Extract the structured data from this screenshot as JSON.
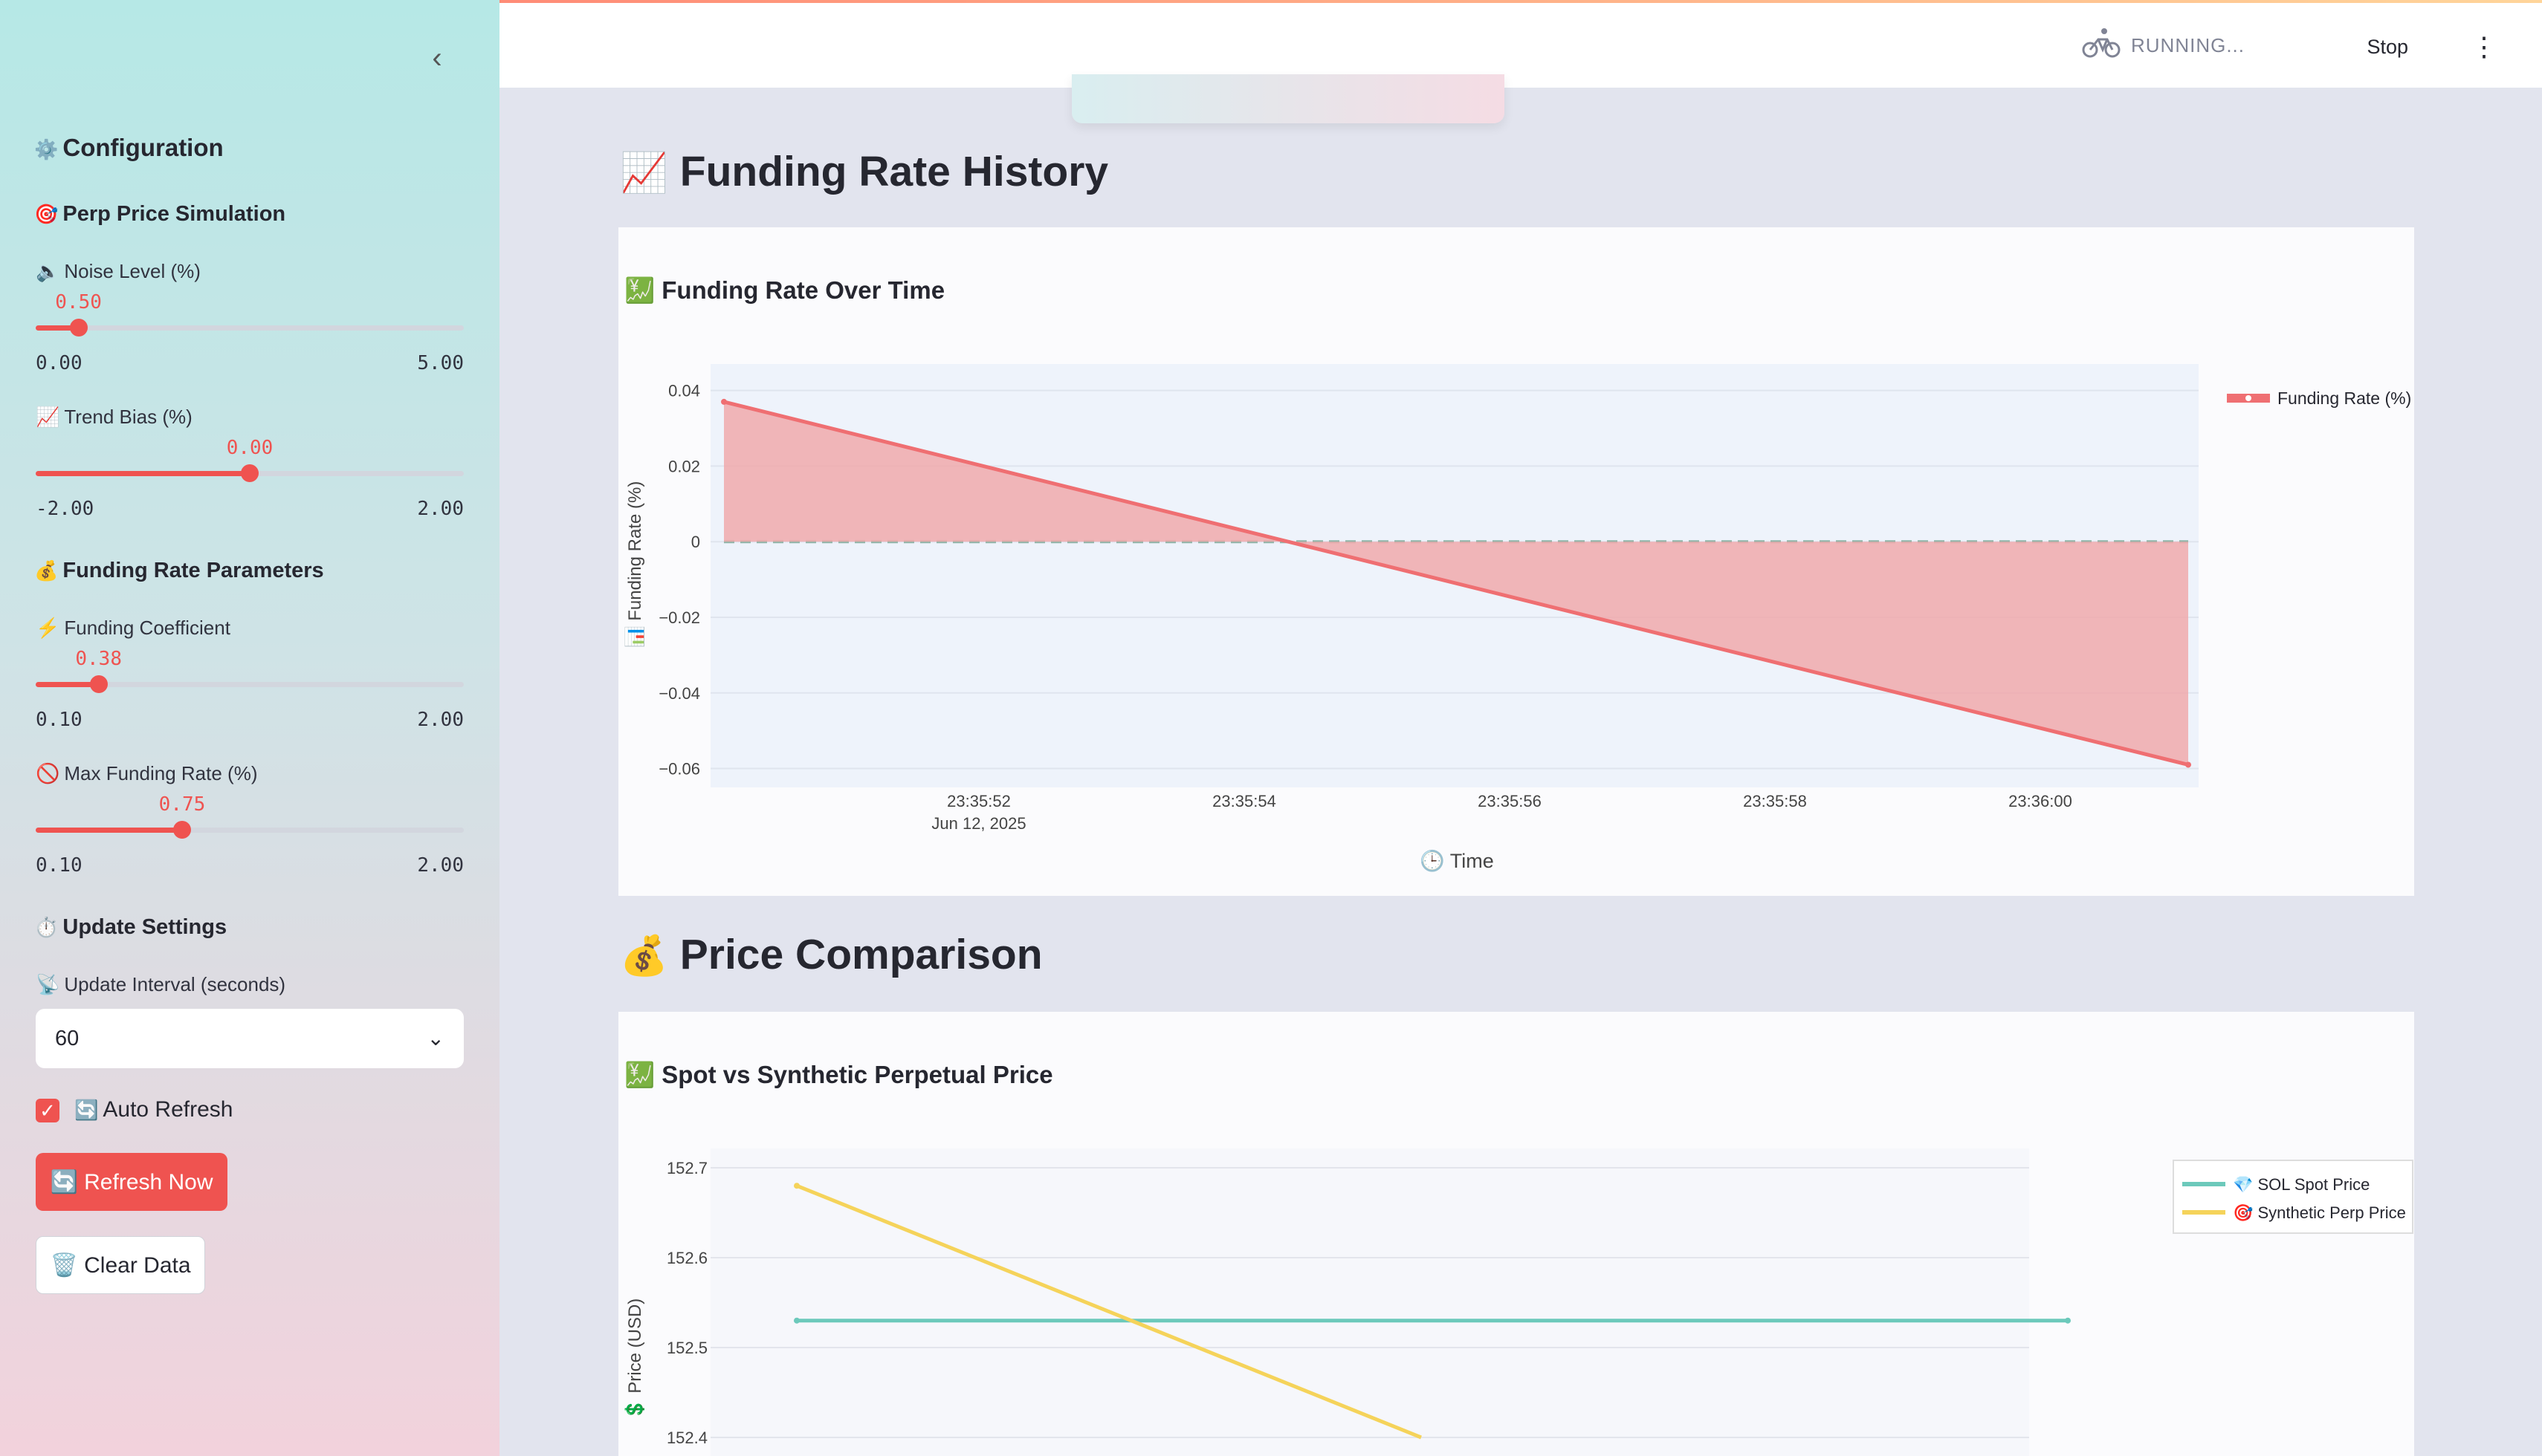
{
  "sidebar": {
    "collapse_icon": "chevron-left-icon",
    "config_title": "Configuration",
    "config_emoji": "⚙️",
    "perp_title": "Perp Price Simulation",
    "perp_emoji": "🎯",
    "noise": {
      "emoji": "🔈",
      "label": "Noise Level (%)",
      "value": "0.50",
      "min": "0.00",
      "max": "5.00",
      "fraction": 0.1
    },
    "trend": {
      "emoji": "📈",
      "label": "Trend Bias (%)",
      "value": "0.00",
      "min": "-2.00",
      "max": "2.00",
      "fraction": 0.5
    },
    "funding_title": "Funding Rate Parameters",
    "funding_emoji": "💰",
    "coef": {
      "emoji": "⚡",
      "label": "Funding Coefficient",
      "value": "0.38",
      "min": "0.10",
      "max": "2.00",
      "fraction": 0.147
    },
    "maxrate": {
      "emoji": "🚫",
      "label": "Max Funding Rate (%)",
      "value": "0.75",
      "min": "0.10",
      "max": "2.00",
      "fraction": 0.342
    },
    "update_title": "Update Settings",
    "update_emoji": "⏱️",
    "interval": {
      "emoji": "📡",
      "label": "Update Interval (seconds)",
      "value": "60"
    },
    "auto_refresh": {
      "emoji": "🔄",
      "label": "Auto Refresh",
      "checked": true
    },
    "refresh_button": "🔄 Refresh Now",
    "clear_button": "🗑️ Clear Data"
  },
  "header": {
    "status": "RUNNING...",
    "stop": "Stop",
    "menu_icon": "more-vertical-icon"
  },
  "sections": {
    "funding_history": {
      "emoji": "📈",
      "title": "Funding Rate History"
    },
    "price_comparison": {
      "emoji": "💰",
      "title": "Price Comparison"
    }
  },
  "colors": {
    "accent": "#ef5350",
    "funding_line": "#ef6f72",
    "funding_fill": "#f0a9ab",
    "spot": "#6cc9bb",
    "perp": "#f5d35a"
  },
  "chart_data": [
    {
      "type": "area",
      "title": "💹 Funding Rate Over Time",
      "ylabel": "📊 Funding Rate (%)",
      "xlabel": "🕒 Time",
      "x_ticks": [
        "23:35:52",
        "23:35:54",
        "23:35:56",
        "23:35:58",
        "23:36:00"
      ],
      "x_sub": "Jun 12, 2025",
      "y_ticks": [
        "0.04",
        "0.02",
        "0",
        "−0.02",
        "−0.04",
        "−0.06"
      ],
      "ylim": [
        -0.065,
        0.047
      ],
      "x": [
        "23:35:50.9",
        "23:36:01.1"
      ],
      "series": [
        {
          "name": "Funding Rate (%)",
          "values": [
            0.037,
            -0.059
          ]
        }
      ],
      "reference_line": 0,
      "legend": "top-right",
      "grid": true
    },
    {
      "type": "line",
      "title": "💹 Spot vs Synthetic Perpetual Price",
      "ylabel": "💲 Price (USD)",
      "y_ticks": [
        "152.7",
        "152.6",
        "152.5",
        "152.4"
      ],
      "ylim": [
        152.38,
        152.72
      ],
      "series": [
        {
          "name": "💎 SOL Spot Price",
          "values": [
            152.53,
            152.53
          ]
        },
        {
          "name": "🎯 Synthetic Perp Price",
          "values": [
            152.68,
            152.4
          ]
        }
      ],
      "legend": "top-right",
      "grid": true
    }
  ]
}
